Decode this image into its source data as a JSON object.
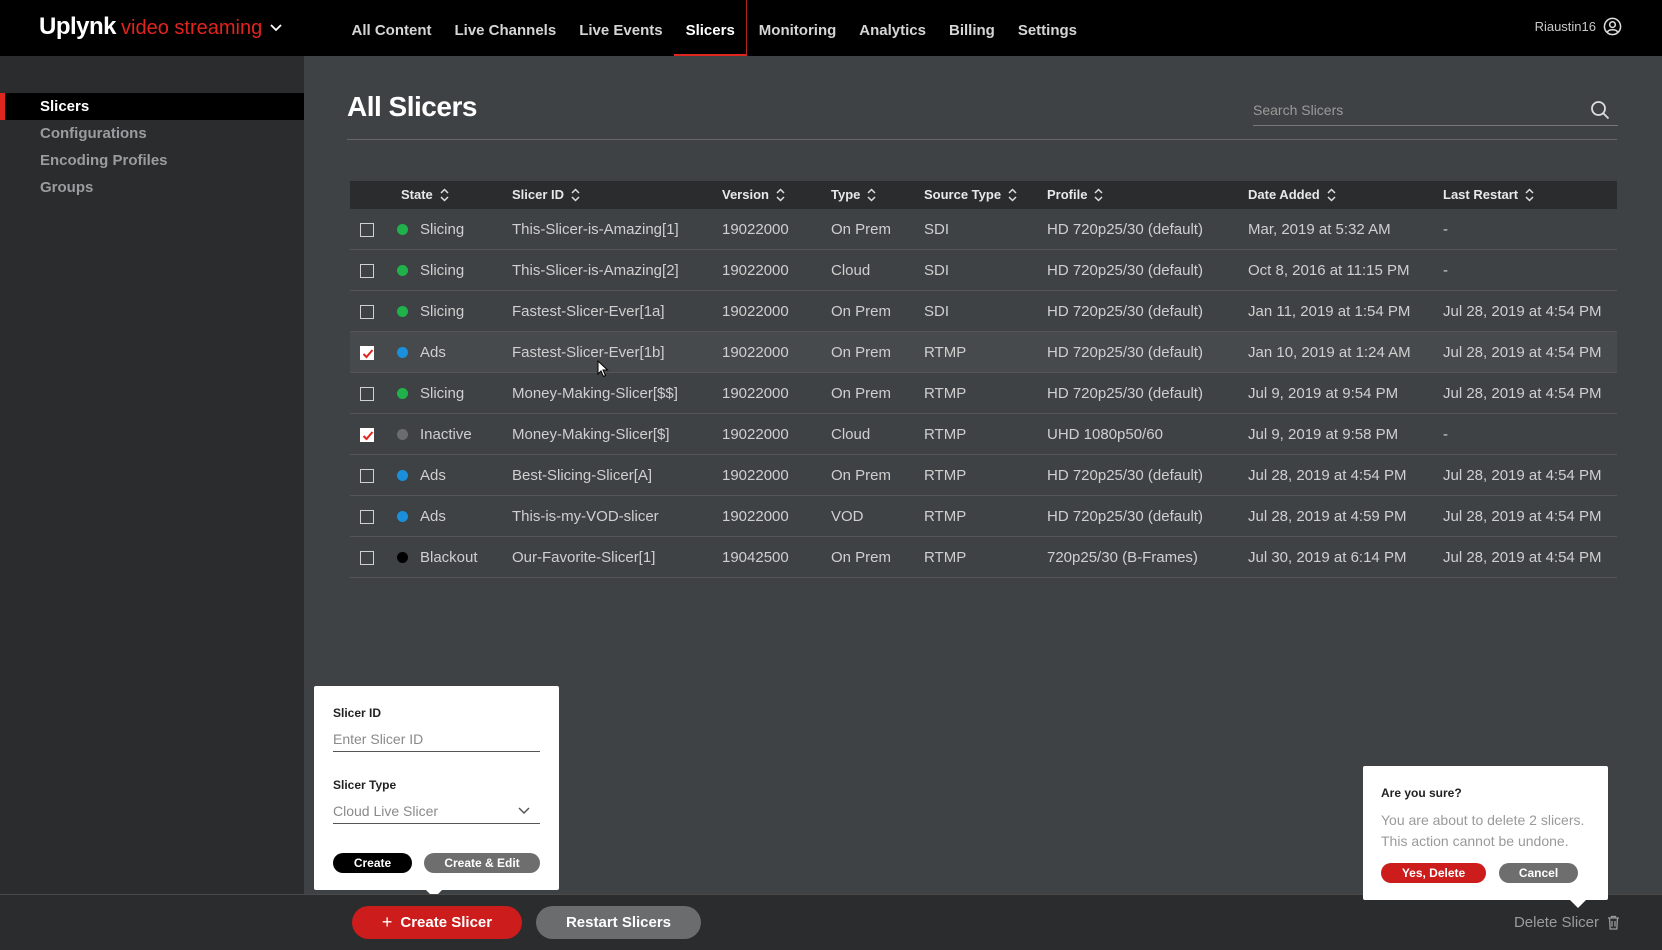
{
  "brand": {
    "name": "Uplynk",
    "sub": "video streaming"
  },
  "nav": [
    {
      "label": "All Content"
    },
    {
      "label": "Live Channels"
    },
    {
      "label": "Live Events"
    },
    {
      "label": "Slicers",
      "active": true
    },
    {
      "label": "Monitoring"
    },
    {
      "label": "Analytics"
    },
    {
      "label": "Billing"
    },
    {
      "label": "Settings"
    }
  ],
  "user": {
    "name": "Riaustin16"
  },
  "sidebar": {
    "items": [
      {
        "label": "Slicers",
        "active": true
      },
      {
        "label": "Configurations"
      },
      {
        "label": "Encoding Profiles"
      },
      {
        "label": "Groups"
      }
    ]
  },
  "page": {
    "title": "All Slicers"
  },
  "search": {
    "placeholder": "Search Slicers"
  },
  "table": {
    "columns": [
      "State",
      "Slicer ID",
      "Version",
      "Type",
      "Source Type",
      "Profile",
      "Date Added",
      "Last Restart"
    ],
    "rows": [
      {
        "checked": false,
        "state_color": "#1fb24a",
        "state": "Slicing",
        "id": "This-Slicer-is-Amazing[1]",
        "version": "19022000",
        "type": "On Prem",
        "source": "SDI",
        "profile": "HD 720p25/30 (default)",
        "added": "Mar, 2019 at 5:32 AM",
        "restart": "-"
      },
      {
        "checked": false,
        "state_color": "#1fb24a",
        "state": "Slicing",
        "id": "This-Slicer-is-Amazing[2]",
        "version": "19022000",
        "type": "Cloud",
        "source": "SDI",
        "profile": "HD 720p25/30 (default)",
        "added": "Oct 8, 2016 at 11:15 PM",
        "restart": "-"
      },
      {
        "checked": false,
        "state_color": "#1fb24a",
        "state": "Slicing",
        "id": "Fastest-Slicer-Ever[1a]",
        "version": "19022000",
        "type": "On Prem",
        "source": "SDI",
        "profile": "HD 720p25/30 (default)",
        "added": "Jan 11, 2019 at 1:54 PM",
        "restart": "Jul 28, 2019 at 4:54 PM"
      },
      {
        "checked": true,
        "state_color": "#1a8fdc",
        "state": "Ads",
        "id": "Fastest-Slicer-Ever[1b]",
        "version": "19022000",
        "type": "On Prem",
        "source": "RTMP",
        "profile": "HD 720p25/30 (default)",
        "added": "Jan 10, 2019 at 1:24 AM",
        "restart": "Jul 28, 2019 at 4:54 PM",
        "highlight": true
      },
      {
        "checked": false,
        "state_color": "#1fb24a",
        "state": "Slicing",
        "id": "Money-Making-Slicer[$$]",
        "version": "19022000",
        "type": "On Prem",
        "source": "RTMP",
        "profile": "HD 720p25/30 (default)",
        "added": "Jul 9, 2019 at 9:54 PM",
        "restart": "Jul 28, 2019 at 4:54 PM"
      },
      {
        "checked": true,
        "state_color": "#6a6c6e",
        "state": "Inactive",
        "id": "Money-Making-Slicer[$]",
        "version": "19022000",
        "type": "Cloud",
        "source": "RTMP",
        "profile": "UHD 1080p50/60",
        "added": "Jul 9, 2019 at 9:58 PM",
        "restart": "-"
      },
      {
        "checked": false,
        "state_color": "#1a8fdc",
        "state": "Ads",
        "id": "Best-Slicing-Slicer[A]",
        "version": "19022000",
        "type": "On Prem",
        "source": "RTMP",
        "profile": "HD 720p25/30 (default)",
        "added": "Jul 28, 2019 at 4:54 PM",
        "restart": "Jul 28, 2019 at 4:54 PM"
      },
      {
        "checked": false,
        "state_color": "#1a8fdc",
        "state": "Ads",
        "id": "This-is-my-VOD-slicer",
        "version": "19022000",
        "type": "VOD",
        "source": "RTMP",
        "profile": "HD 720p25/30 (default)",
        "added": "Jul 28, 2019 at 4:59 PM",
        "restart": "Jul 28, 2019 at 4:54 PM"
      },
      {
        "checked": false,
        "state_color": "#000000",
        "state": "Blackout",
        "id": "Our-Favorite-Slicer[1]",
        "version": "19042500",
        "type": "On Prem",
        "source": "RTMP",
        "profile": "720p25/30 (B-Frames)",
        "added": "Jul 30, 2019 at 6:14 PM",
        "restart": "Jul 28, 2019 at 4:54 PM"
      }
    ]
  },
  "create_popover": {
    "id_label": "Slicer ID",
    "id_placeholder": "Enter Slicer ID",
    "type_label": "Slicer Type",
    "type_value": "Cloud Live Slicer",
    "create_label": "Create",
    "create_edit_label": "Create & Edit"
  },
  "confirm_popover": {
    "title": "Are you sure?",
    "message": "You are about to delete 2 slicers. This action cannot be undone.",
    "yes_label": "Yes, Delete",
    "cancel_label": "Cancel"
  },
  "bottombar": {
    "create_label": "Create Slicer",
    "restart_label": "Restart Slicers",
    "delete_label": "Delete Slicer"
  },
  "colors": {
    "accent": "#e0241e",
    "danger_button": "#cc1c1c",
    "topbar": "#000000",
    "background": "#3f4244",
    "panel": "#2a2c2e"
  }
}
